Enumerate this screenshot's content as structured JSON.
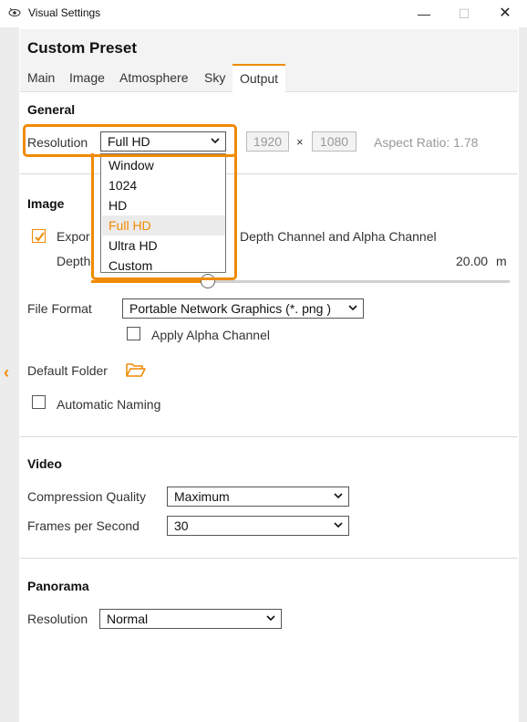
{
  "window": {
    "title": "Visual Settings",
    "minimize": "—",
    "maximize": "☐",
    "close": "✕"
  },
  "preset": {
    "title": "Custom Preset"
  },
  "tabs": [
    "Main",
    "Image",
    "Atmosphere",
    "Sky",
    "Output"
  ],
  "general": {
    "title": "General",
    "resolution_label": "Resolution",
    "resolution_value": "Full HD",
    "width": "1920",
    "times": "×",
    "height": "1080",
    "aspect_ratio": "Aspect Ratio: 1.78",
    "dropdown_options": [
      "Window",
      "1024",
      "HD",
      "Full HD",
      "Ultra HD",
      "Custom"
    ],
    "selected_option": "Full HD"
  },
  "image": {
    "title": "Image",
    "export_label_left": "Expor",
    "export_label_right": "Depth Channel and Alpha Channel",
    "export_checked": true,
    "depth_label": "Depth",
    "depth_value": "20.00",
    "depth_unit": "m",
    "file_format_label": "File Format",
    "file_format_value": "Portable Network Graphics  (*. png )",
    "apply_alpha_label": "Apply Alpha Channel",
    "apply_alpha_checked": false,
    "default_folder_label": "Default Folder",
    "automatic_naming_label": "Automatic Naming",
    "automatic_naming_checked": false
  },
  "video": {
    "title": "Video",
    "compression_label": "Compression Quality",
    "compression_value": "Maximum",
    "fps_label": "Frames per Second",
    "fps_value": "30"
  },
  "panorama": {
    "title": "Panorama",
    "resolution_label": "Resolution",
    "resolution_value": "Normal"
  },
  "colors": {
    "accent": "#f08a00",
    "text": "#1a1a1a",
    "muted": "#999999"
  },
  "icons": {
    "app": "eye-icon",
    "collapse": "chevron-left-icon",
    "folder": "folder-open-icon",
    "dropdown": "chevron-down-icon"
  }
}
